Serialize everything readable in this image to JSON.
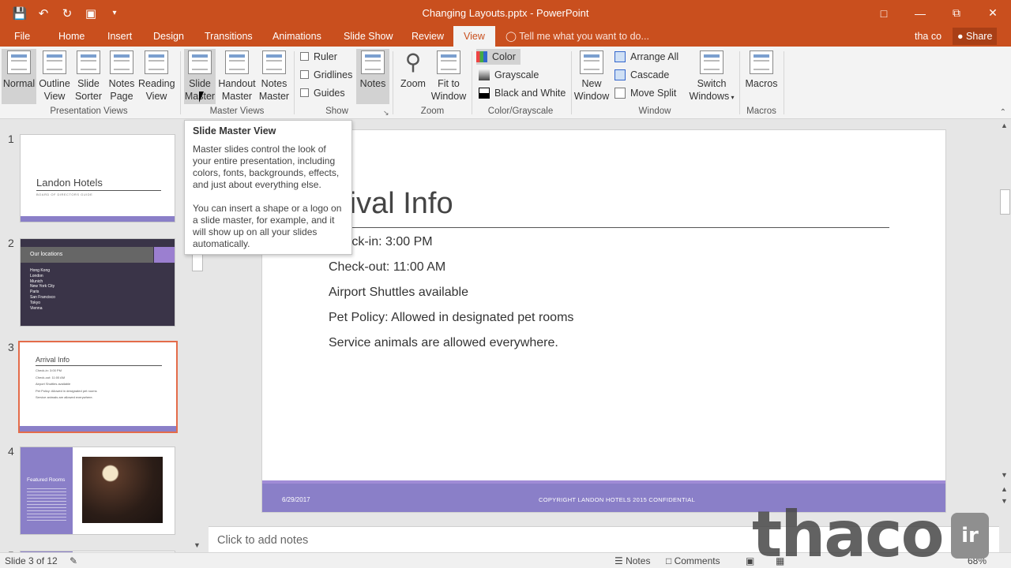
{
  "window": {
    "title": "Changing Layouts.pptx - PowerPoint",
    "user": "tha co",
    "share": "Share"
  },
  "tabs": [
    "File",
    "Home",
    "Insert",
    "Design",
    "Transitions",
    "Animations",
    "Slide Show",
    "Review",
    "View"
  ],
  "tell_me": "Tell me what you want to do...",
  "ribbon": {
    "presentation_views": {
      "label": "Presentation Views",
      "buttons": [
        {
          "l1": "Normal",
          "l2": ""
        },
        {
          "l1": "Outline",
          "l2": "View"
        },
        {
          "l1": "Slide",
          "l2": "Sorter"
        },
        {
          "l1": "Notes",
          "l2": "Page"
        },
        {
          "l1": "Reading",
          "l2": "View"
        }
      ]
    },
    "master_views": {
      "label": "Master Views",
      "buttons": [
        {
          "l1": "Slide",
          "l2": "Master"
        },
        {
          "l1": "Handout",
          "l2": "Master"
        },
        {
          "l1": "Notes",
          "l2": "Master"
        }
      ]
    },
    "show": {
      "label": "Show",
      "checks": [
        "Ruler",
        "Gridlines",
        "Guides"
      ],
      "notes": "Notes"
    },
    "zoom": {
      "label": "Zoom",
      "zoom": "Zoom",
      "fit1": "Fit to",
      "fit2": "Window"
    },
    "color": {
      "label": "Color/Grayscale",
      "items": [
        "Color",
        "Grayscale",
        "Black and White"
      ]
    },
    "window": {
      "label": "Window",
      "new1": "New",
      "new2": "Window",
      "items": [
        "Arrange All",
        "Cascade",
        "Move Split"
      ],
      "switch1": "Switch",
      "switch2": "Windows"
    },
    "macros": {
      "label": "Macros",
      "button": "Macros"
    }
  },
  "tooltip": {
    "title": "Slide Master View",
    "p1": "Master slides control the look of your entire presentation, including colors, fonts, backgrounds, effects, and just about everything else.",
    "p2": "You can insert a shape or a logo on a slide master, for example, and it will show up on all your slides automatically."
  },
  "thumbnails": {
    "numbers": [
      "1",
      "2",
      "3",
      "4",
      "5"
    ],
    "t1": {
      "title": "Landon Hotels",
      "sub": "BOARD OF DIRECTORS GUIDE"
    },
    "t2": {
      "title": "Our locations",
      "items": [
        "Hong Kong",
        "London",
        "Munich",
        "New York City",
        "Paris",
        "San Francisco",
        "Tokyo",
        "Vienna"
      ]
    },
    "t3": {
      "title": "Arrival Info",
      "items": [
        "Check-in: 3:00 PM",
        "Check-out: 11:00 AM",
        "Airport Shuttles available",
        "Pet Policy: Allowed in designated pet rooms",
        "Service animals are allowed everywhere."
      ]
    },
    "t4": {
      "title": "Featured Rooms"
    }
  },
  "slide": {
    "title": "Arrival Info",
    "bullets": [
      "Check-in: 3:00 PM",
      "Check-out: 11:00 AM",
      "Airport Shuttles available",
      "Pet Policy: Allowed in designated pet rooms",
      "Service animals are allowed everywhere."
    ],
    "footer_date": "6/29/2017",
    "footer_copy": "COPYRIGHT LANDON HOTELS 2015 CONFIDENTIAL"
  },
  "notes_placeholder": "Click to add notes",
  "status": {
    "slide": "Slide 3 of 12",
    "notes": "Notes",
    "comments": "Comments",
    "zoom": "68%"
  },
  "watermark": {
    "text": "thaco",
    "badge": "ir"
  },
  "colors": {
    "accent": "#c94f1e",
    "ribbon": "#f3f3f3",
    "footer": "#8a7fc8"
  }
}
